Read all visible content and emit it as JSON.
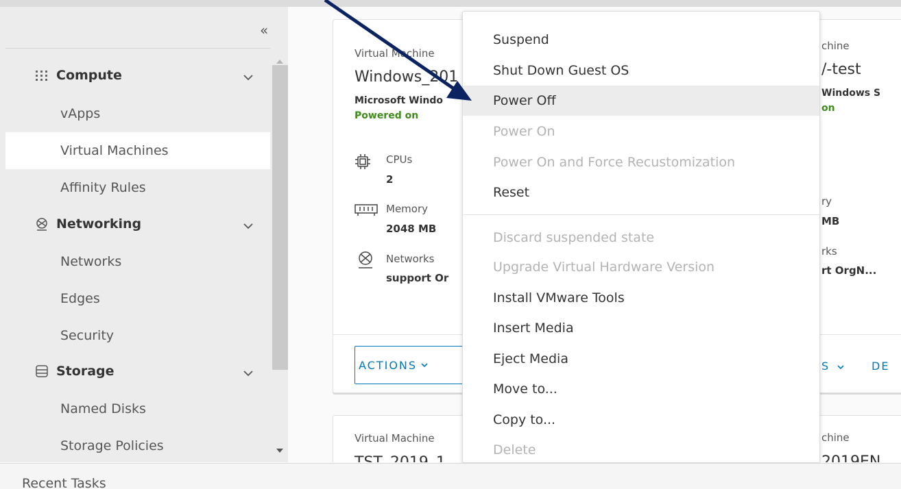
{
  "sidebar": {
    "collapse_icon": "double-chevron-left-icon",
    "groups": [
      {
        "label": "Compute",
        "icon": "grid-icon"
      },
      {
        "label": "Networking",
        "icon": "network-icon"
      },
      {
        "label": "Storage",
        "icon": "database-icon"
      }
    ],
    "items": [
      {
        "label": "vApps"
      },
      {
        "label": "Virtual Machines",
        "active": true
      },
      {
        "label": "Affinity Rules"
      },
      {
        "label": "Networks"
      },
      {
        "label": "Edges"
      },
      {
        "label": "Security"
      },
      {
        "label": "Named Disks"
      },
      {
        "label": "Storage Policies"
      }
    ]
  },
  "cards": [
    {
      "label": "Virtual Machine",
      "name": "Windows_201",
      "os": "Microsoft Windo",
      "status": "Powered on",
      "cpus_label": "CPUs",
      "cpus_value": "2",
      "memory_label": "Memory",
      "memory_value": "2048 MB",
      "networks_label": "Networks",
      "networks_value": "support Or",
      "actions_label": "ACTIONS"
    },
    {
      "label": "chine",
      "name": "/-test",
      "os": "Windows S",
      "status": "on",
      "memory_label": "ry",
      "memory_value": "MB",
      "networks_label": "rks",
      "networks_value": "rt OrgN...",
      "link1_label": "S",
      "link2_label": "DE"
    },
    {
      "label": "Virtual Machine",
      "name": "TST_2019_1"
    },
    {
      "label": "chine",
      "name": "2019EN"
    }
  ],
  "menu": {
    "items": [
      {
        "label": "Suspend",
        "enabled": true
      },
      {
        "label": "Shut Down Guest OS",
        "enabled": true
      },
      {
        "label": "Power Off",
        "enabled": true,
        "hovered": true
      },
      {
        "label": "Power On",
        "enabled": false
      },
      {
        "label": "Power On and Force Recustomization",
        "enabled": false
      },
      {
        "label": "Reset",
        "enabled": true
      },
      {
        "label": "Discard suspended state",
        "enabled": false
      },
      {
        "label": "Upgrade Virtual Hardware Version",
        "enabled": false
      },
      {
        "label": "Install VMware Tools",
        "enabled": true
      },
      {
        "label": "Insert Media",
        "enabled": true
      },
      {
        "label": "Eject Media",
        "enabled": true
      },
      {
        "label": "Move to...",
        "enabled": true
      },
      {
        "label": "Copy to...",
        "enabled": true
      },
      {
        "label": "Delete",
        "enabled": false
      }
    ]
  },
  "footer": {
    "recent_tasks_label": "Recent Tasks"
  },
  "colors": {
    "link": "#0079b8",
    "status_on": "#3f8c1b",
    "disabled_text": "#b3b3b3",
    "annotation_arrow": "#0b2461"
  }
}
